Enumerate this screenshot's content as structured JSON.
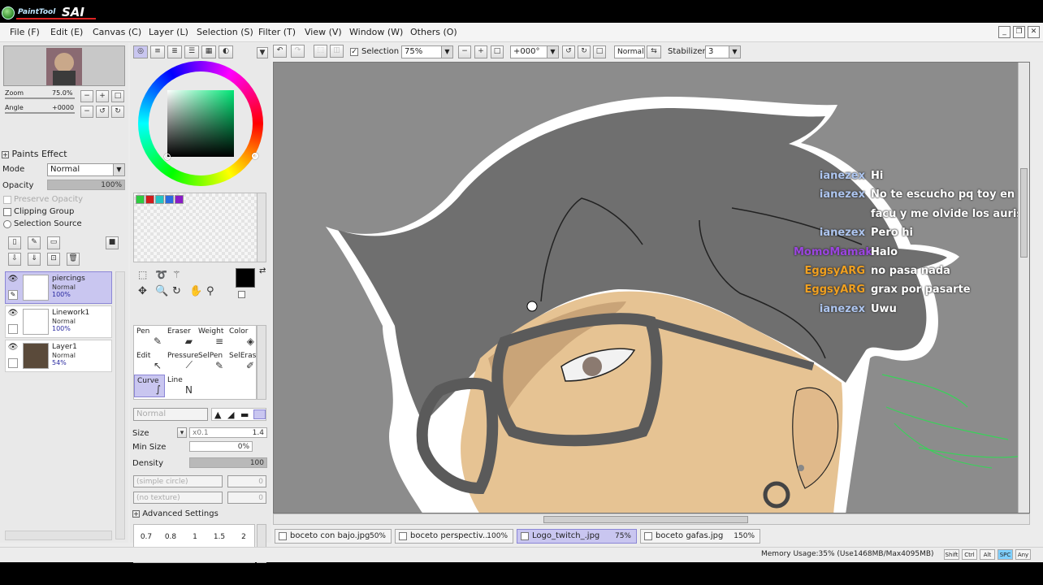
{
  "app": {
    "logo_text": "PaintTool",
    "logo_sai": "SAI"
  },
  "menu": [
    {
      "label": "File (F)"
    },
    {
      "label": "Edit (E)"
    },
    {
      "label": "Canvas (C)"
    },
    {
      "label": "Layer (L)"
    },
    {
      "label": "Selection (S)"
    },
    {
      "label": "Filter (T)"
    },
    {
      "label": "View (V)"
    },
    {
      "label": "Window (W)"
    },
    {
      "label": "Others (O)"
    }
  ],
  "toolbar": {
    "selection_label": "Selection",
    "zoom_value": "75%",
    "angle_value": "+000°",
    "blend_value": "Normal",
    "stabilizer_label": "Stabilizer",
    "stabilizer_value": "3"
  },
  "navigator": {
    "zoom_label": "Zoom",
    "zoom_value": "75.0%",
    "angle_label": "Angle",
    "angle_value": "+0000"
  },
  "paint_effect": {
    "title": "Paints Effect",
    "mode_label": "Mode",
    "mode_value": "Normal",
    "opacity_label": "Opacity",
    "opacity_value": "100%",
    "opacity_fraction": 1.0,
    "preserve_opacity": "Preserve Opacity",
    "clipping_group": "Clipping Group",
    "selection_source": "Selection Source"
  },
  "layers": [
    {
      "name": "piercings",
      "mode": "Normal",
      "opacity": "100%",
      "selected": true
    },
    {
      "name": "Linework1",
      "mode": "Normal",
      "opacity": "100%",
      "selected": false
    },
    {
      "name": "Layer1",
      "mode": "Normal",
      "opacity": "54%",
      "selected": false
    }
  ],
  "tools": [
    {
      "label": "Pen",
      "icon": "pen-icon",
      "glyph": "✎"
    },
    {
      "label": "Eraser",
      "icon": "eraser-icon",
      "glyph": "▰"
    },
    {
      "label": "Weight",
      "icon": "weight-icon",
      "glyph": "≡"
    },
    {
      "label": "Color",
      "icon": "color-icon",
      "glyph": "◈"
    },
    {
      "label": "Edit",
      "icon": "edit-icon",
      "glyph": "↖"
    },
    {
      "label": "Pressure",
      "icon": "pressure-icon",
      "glyph": "⟋"
    },
    {
      "label": "SelPen",
      "icon": "selpen-icon",
      "glyph": "✎"
    },
    {
      "label": "SelEras",
      "icon": "seleras-icon",
      "glyph": "✐"
    },
    {
      "label": "Curve",
      "icon": "curve-icon",
      "glyph": "∫",
      "selected": true
    },
    {
      "label": "Line",
      "icon": "line-icon",
      "glyph": "N"
    }
  ],
  "brush": {
    "mode_value": "Normal",
    "size_label": "Size",
    "size_mult": "x0.1",
    "size_value": "1.4",
    "min_size_label": "Min Size",
    "min_size_value": "0%",
    "density_label": "Density",
    "density_value": "100",
    "density_fraction": 1.0,
    "shape_value": "(simple circle)",
    "shape_num": "0",
    "texture_value": "(no texture)",
    "texture_num": "0",
    "advanced": "Advanced Settings",
    "presets": [
      "0.7",
      "0.8",
      "1",
      "1.5",
      "2"
    ]
  },
  "swatches": [
    "#2ecc40",
    "#d11b1b",
    "#23c4c4",
    "#2a6be0",
    "#8a1bc7"
  ],
  "primary_color": "#000000",
  "chat": [
    {
      "user": "ianezex",
      "msg": "Hi",
      "color": "#aec6f0"
    },
    {
      "user": "ianezex",
      "msg": "No te escucho pq toy en la",
      "color": "#aec6f0"
    },
    {
      "user": "",
      "msg": "facu y me olvide los auris",
      "color": "#aec6f0"
    },
    {
      "user": "ianezex",
      "msg": "Pero hi",
      "color": "#aec6f0"
    },
    {
      "user": "MomoMamak",
      "msg": "Halo",
      "color": "#9b45e0"
    },
    {
      "user": "EggsyARG",
      "msg": "no pasa nada",
      "color": "#f0a020"
    },
    {
      "user": "EggsyARG",
      "msg": "grax por pasarte",
      "color": "#f0a020"
    },
    {
      "user": "ianezex",
      "msg": "Uwu",
      "color": "#aec6f0"
    }
  ],
  "documents": [
    {
      "name": "boceto con bajo.jpg",
      "zoom": "50%",
      "selected": false
    },
    {
      "name": "boceto perspectiv...",
      "zoom": "100%",
      "selected": false
    },
    {
      "name": "Logo_twitch_.jpg",
      "zoom": "75%",
      "selected": true
    },
    {
      "name": "boceto gafas.jpg",
      "zoom": "150%",
      "selected": false
    }
  ],
  "status": {
    "memory": "Memory Usage:35% (Use1468MB/Max4095MB)",
    "keys": [
      "Shift",
      "Ctrl",
      "Alt",
      "SPC",
      "Any"
    ]
  }
}
